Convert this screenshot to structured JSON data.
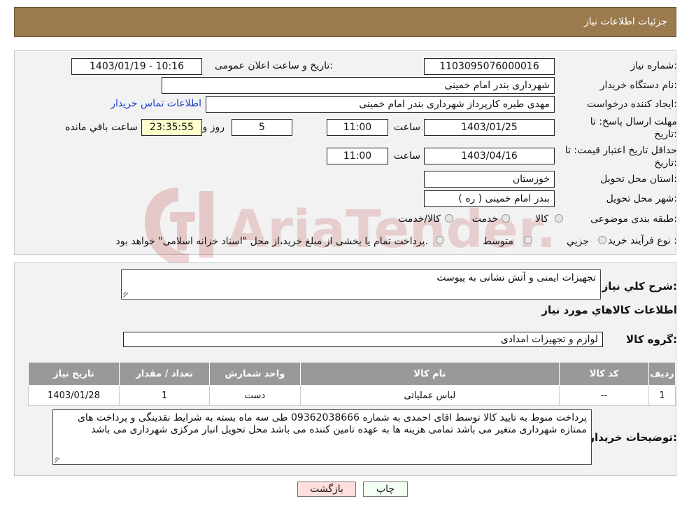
{
  "header": {
    "title": "جزئیات اطلاعات نیاز"
  },
  "form": {
    "need_number_label": "شماره نیاز:",
    "need_number": "1103095076000016",
    "announce_label": "تاریخ و ساعت اعلان عمومی:",
    "announce_value": "1403/01/19 - 10:16",
    "buyer_org_label": "نام دستگاه خریدار:",
    "buyer_org": "شهرداری بندر امام خمینی",
    "creator_label": "ایجاد کننده درخواست:",
    "creator": "مهدی طیره کارپرداز شهرداری بندر امام خمینی",
    "contact_link": "اطلاعات تماس خریدار",
    "reply_deadline_label": "مهلت ارسال پاسخ: تا تاریخ:",
    "reply_date": "1403/01/25",
    "time_label": "ساعت",
    "reply_time": "11:00",
    "days_value": "5",
    "days_label": "روز و",
    "remaining_time": "23:35:55",
    "remaining_label": "ساعت باقي مانده",
    "price_validity_label": "حداقل تاریخ اعتبار قیمت: تا تاریخ:",
    "price_date": "1403/04/16",
    "price_time": "11:00",
    "province_label": "استان محل تحویل:",
    "province": "خوزستان",
    "city_label": "شهر محل تحویل:",
    "city": "بندر امام خمینی ( ره )",
    "category_label": "طبقه بندی موضوعی:",
    "category_options": [
      "کالا",
      "خدمت",
      "کالا/خدمت"
    ],
    "process_label": "نوع فرآیند خرید :",
    "process_options": [
      "جزيي",
      "متوسط"
    ],
    "process_note": "پرداخت تمام یا بخشی از مبلغ خرید،از محل \"اسناد خزانه اسلامی\" خواهد بود."
  },
  "details": {
    "general_label": "شرح کلي نیاز:",
    "general_value": "تجهیزات ایمنی و آتش نشانی به پیوست",
    "goods_title": "اطلاعات کالاهاي مورد نیاز",
    "group_label": "گروه کالا:",
    "group_value": "لوازم و تجهیزات امدادی",
    "table": {
      "headers": [
        "ردیف",
        "کد کالا",
        "نام کالا",
        "واحد شمارش",
        "تعداد / مقدار",
        "تاریخ نیاز"
      ],
      "rows": [
        [
          "1",
          "--",
          "لباس عملیاتی",
          "دست",
          "1",
          "1403/01/28"
        ]
      ]
    },
    "buyer_notes_label": "توضیحات خریدار:",
    "buyer_notes": "پرداخت منوط به تایید کالا توسط اقای احمدی به شماره  09362038666 طی سه ماه بسته به شرایط نقدینگی و پرداخت های ممتازه شهرداری متغیر می باشد تمامی هزینه ها به عهده تامین کننده می باشد محل تحویل انبار مرکزی شهرداری می باشد"
  },
  "buttons": {
    "print": "چاپ",
    "back": "بازگشت"
  },
  "watermark": "AriaTender.neT"
}
